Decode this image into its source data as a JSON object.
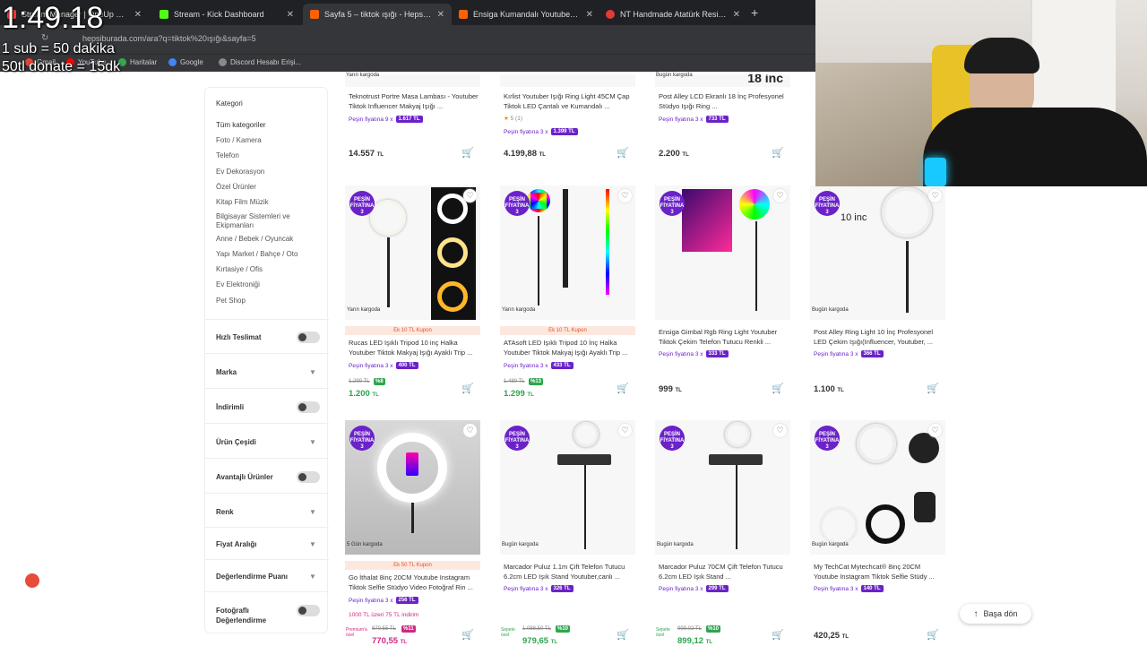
{
  "browser": {
    "tabs": [
      {
        "label": "Stream Manager | OneUp Videos",
        "color": "#ff3b30",
        "active": false
      },
      {
        "label": "Stream - Kick Dashboard",
        "color": "#53fc18",
        "active": false
      },
      {
        "label": "Sayfa 5 – tiktok ışığı - Hepsiburada",
        "color": "#ff6000",
        "active": true
      },
      {
        "label": "Ensiga Kumandalı Youtuber Tiktok",
        "color": "#ff6000",
        "active": false
      },
      {
        "label": "NT Handmade Atatürk Resimleri",
        "color": "#e53935",
        "active": false
      }
    ],
    "url": "hepsiburada.com/ara?q=tiktok%20ışığı&sayfa=5",
    "bookmarks": [
      "Gmail",
      "YouTube",
      "Haritalar",
      "Google",
      "Discord Hesabı Erişi..."
    ]
  },
  "overlay": {
    "timer": "1:49.18",
    "line1": "1 sub = 50 dakika",
    "line2": "50tl donate = 15dk"
  },
  "sidebar": {
    "title": "Kategori",
    "categories": [
      "Tüm kategoriler",
      "Foto / Kamera",
      "Telefon",
      "Ev Dekorasyon",
      "Özel Ürünler",
      "Kitap Film Müzik",
      "Bilgisayar Sistemleri ve Ekipmanları",
      "Anne / Bebek / Oyuncak",
      "Yapı Market / Bahçe / Oto",
      "Kırtasiye / Ofis",
      "Ev Elektroniği",
      "Pet Shop"
    ],
    "filters": [
      {
        "label": "Hızlı Teslimat",
        "kind": "toggle"
      },
      {
        "label": "Marka",
        "kind": "expand"
      },
      {
        "label": "İndirimli",
        "kind": "toggle"
      },
      {
        "label": "Ürün Çeşidi",
        "kind": "expand"
      },
      {
        "label": "Avantajlı Ürünler",
        "kind": "toggle"
      },
      {
        "label": "Renk",
        "kind": "expand"
      },
      {
        "label": "Fiyat Aralığı",
        "kind": "expand"
      },
      {
        "label": "Değerlendirme Puanı",
        "kind": "expand"
      },
      {
        "label": "Fotoğraflı Değerlendirme",
        "kind": "toggle"
      }
    ]
  },
  "products": {
    "row1": [
      {
        "title": "Teknotrust Portre Masa Lambası - Youtuber Tiktok Influencer Makyaj Işığı ...",
        "cash": "Peşin fiyatına 9 x",
        "cash_amt": "1.617 TL",
        "price": "14.557",
        "currency": "TL",
        "ship": "Yarın kargoda"
      },
      {
        "title": "Kırlist Youtuber Işığı Ring Light 45CM Çap Tiktok LED Çantalı ve Kumandalı ...",
        "rating": "5 (1)",
        "cash": "Peşin fiyatına 3 x",
        "cash_amt": "1.399 TL",
        "price": "4.199,88",
        "currency": "TL",
        "ship": ""
      },
      {
        "title": "Post Alley LCD Ekranlı 18 İnç Profesyonel Stüdyo Işığı Ring ...",
        "cash": "Peşin fiyatına 3 x",
        "cash_amt": "733 TL",
        "price": "2.200",
        "currency": "TL",
        "ship": "Bugün kargoda",
        "img_text": "18 inc"
      }
    ],
    "row2": [
      {
        "title": "Rucas LED Işıklı Tripod 10 inç Halka Youtuber Tiktok Makyaj Işığı Ayaklı Trip ...",
        "coupon": "Ek 10 TL Kupon",
        "cash": "Peşin fiyatına 3 x",
        "cash_amt": "400 TL",
        "old": "1.299 TL",
        "disc": "%8",
        "price": "1.200",
        "currency": "TL",
        "ship": "Yarın kargoda",
        "badge": "PEŞİN FİYATINA 3 TAKSİT"
      },
      {
        "title": "ATAsoft LED Işıklı Tripod 10 İnç Halka Youtuber Tiktok Makyaj Işığı Ayaklı Trip ...",
        "coupon": "Ek 10 TL Kupon",
        "cash": "Peşin fiyatına 3 x",
        "cash_amt": "433 TL",
        "old": "1.489 TL",
        "disc": "%13",
        "price": "1.299",
        "currency": "TL",
        "ship": "Yarın kargoda",
        "badge": "PEŞİN FİYATINA 3 TAKSİT"
      },
      {
        "title": "Ensiga Gimbal Rgb Ring Light Youtuber Tiktok Çekim Telefon Tutucu Renkli ...",
        "cash": "Peşin fiyatına 3 x",
        "cash_amt": "333 TL",
        "price": "999",
        "currency": "TL",
        "ship": "",
        "badge": "PEŞİN FİYATINA 3 TAKSİT"
      },
      {
        "title": "Post Alley Ring Light 10 İnç Profesyonel LED Çekim Işığı(Influencer, Youtuber, ...",
        "cash": "Peşin fiyatına 3 x",
        "cash_amt": "366 TL",
        "price": "1.100",
        "currency": "TL",
        "ship": "Bugün kargoda",
        "badge": "PEŞİN FİYATINA 3 TAKSİT",
        "img_text": "10 inc"
      }
    ],
    "row3": [
      {
        "title": "Go İthalat 8inç 20CM Youtube Instagram Tiktok Selfie Stüdyo Video Fotoğraf Rin ...",
        "coupon": "Ek 50 TL Kupon",
        "cash": "Peşin fiyatına 3 x",
        "cash_amt": "256 TL",
        "promo": "1000 TL üzeri 75 TL indirim",
        "side_tag": "Premium'a özel",
        "old": "870,55 TL",
        "disc": "%11",
        "price": "770,55",
        "currency": "TL",
        "ship": "5 Gün kargoda",
        "badge": "PEŞİN FİYATINA 3 TAKSİT"
      },
      {
        "title": "Marcador Puluz 1.1m Çift Telefon Tutucu 6.2cm LED Işık Stand Youtuber,canlı ...",
        "cash": "Peşin fiyatına 3 x",
        "cash_amt": "326 TL",
        "side_tag": "Sepete özel",
        "old": "1.088,50 TL",
        "disc": "%10",
        "price": "979,65",
        "currency": "TL",
        "ship": "Bugün kargoda",
        "badge": "PEŞİN FİYATINA 3 TAKSİT"
      },
      {
        "title": "Marcador Puluz 70CM Çift Telefon Tutucu 6.2cm LED Işık Stand ...",
        "cash": "Peşin fiyatına 3 x",
        "cash_amt": "299 TL",
        "side_tag": "Sepete özel",
        "old": "999,02 TL",
        "disc": "%10",
        "price": "899,12",
        "currency": "TL",
        "ship": "Bugün kargoda",
        "badge": "PEŞİN FİYATINA 3 TAKSİT"
      },
      {
        "title": "My TechCat Mytechcat® 8inç 20CM Youtube Instagram Tiktok Selfie Stüdy ...",
        "cash": "Peşin fiyatına 3 x",
        "cash_amt": "140 TL",
        "price": "420,25",
        "currency": "TL",
        "ship": "Bugün kargoda",
        "badge": "PEŞİN FİYATINA 3 TAKSİT"
      }
    ]
  },
  "back_to_top": "Başa dön",
  "colors": {
    "brand": "#ff6000",
    "purple": "#6b22c9",
    "green": "#2fa44f",
    "coupon": "#e1522b"
  }
}
